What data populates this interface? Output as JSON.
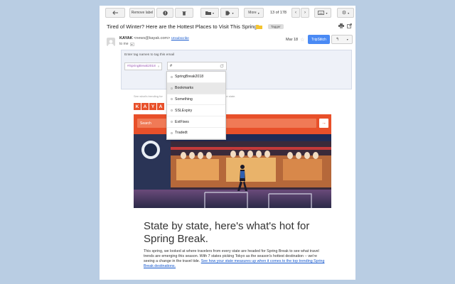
{
  "toolbar": {
    "remove_label": "Remove label",
    "more_label": "More",
    "pager": "13 of 178"
  },
  "message": {
    "subject": "Tired of Winter? Here are the Hottest Places to Visit This Spring.",
    "badge": "Tagger",
    "sender_name": "KAYAK",
    "sender_email": "<news@kayak.com>",
    "unsubscribe": "Unsubscribe",
    "to": "to me",
    "date": "Mar 18",
    "tripstitch": "TripStitch"
  },
  "tagger": {
    "prompt": "Enter tag names to tag this email",
    "chip": "#SpringBreak2018",
    "input_value": "#",
    "suggestions": [
      "SpringBreak2018",
      "Bookmarks",
      "Something",
      "SSLExpiry",
      "ExtFixes",
      "Tradedt"
    ],
    "highlighted_index": 1
  },
  "email_body": {
    "preheader": "See what's trending for",
    "preheader_tail": "me state.",
    "logo_letters": [
      "K",
      "A",
      "Y",
      "A"
    ],
    "search_label": "Search",
    "search_arrow": "→",
    "headline": "State by state, here's what's hot for Spring Break.",
    "body": "This spring, we looked at where travelers from every state are headed for Spring Break to see what travel trends are emerging this season. With 7 states picking Tokyo as the season's hottest destination -- we're seeing a change in the travel tide.",
    "link": "See how your state measures up when it comes to the top trending Spring Break destinations."
  },
  "colors": {
    "accent": "#e8502a",
    "button_blue": "#4a8af4",
    "page_bg": "#b9cde3"
  }
}
